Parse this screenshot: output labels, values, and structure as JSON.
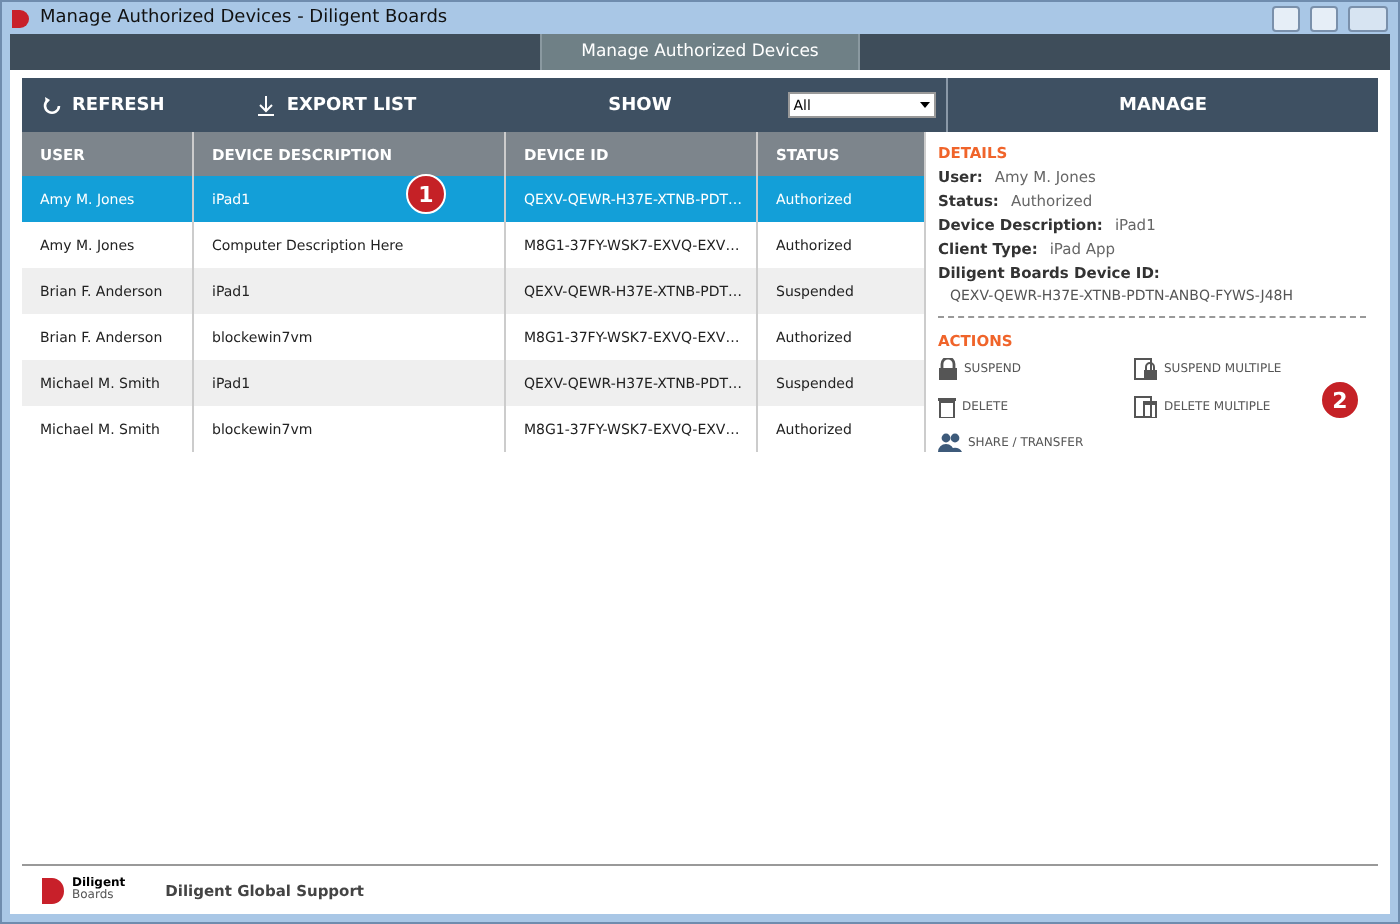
{
  "window": {
    "title": "Manage Authorized Devices - Diligent Boards"
  },
  "tabs": [
    {
      "label": "Manage Authorized Devices",
      "selected": true
    }
  ],
  "toolbar": {
    "refresh": "REFRESH",
    "export": "EXPORT LIST",
    "show_label": "SHOW",
    "show_value": "All",
    "manage": "MANAGE"
  },
  "table": {
    "columns": [
      "USER",
      "DEVICE DESCRIPTION",
      "DEVICE ID",
      "STATUS"
    ],
    "rows": [
      {
        "cells": [
          "Amy M. Jones",
          "iPad1",
          "QEXV-QEWR-H37E-XTNB-PDT…",
          "Authorized"
        ],
        "selected": true
      },
      {
        "cells": [
          "Amy M. Jones",
          "Computer Description Here",
          "M8G1-37FY-WSK7-EXVQ-EXV…",
          "Authorized"
        ],
        "selected": false
      },
      {
        "cells": [
          "Brian F. Anderson",
          "iPad1",
          "QEXV-QEWR-H37E-XTNB-PDT…",
          "Suspended"
        ],
        "selected": false
      },
      {
        "cells": [
          "Brian F. Anderson",
          "blockewin7vm",
          "M8G1-37FY-WSK7-EXVQ-EXV…",
          "Authorized"
        ],
        "selected": false
      },
      {
        "cells": [
          "Michael M. Smith",
          "iPad1",
          "QEXV-QEWR-H37E-XTNB-PDT…",
          "Suspended"
        ],
        "selected": false
      },
      {
        "cells": [
          "Michael M. Smith",
          "blockewin7vm",
          "M8G1-37FY-WSK7-EXVQ-EXV…",
          "Authorized"
        ],
        "selected": false
      }
    ]
  },
  "details": {
    "heading": "DETAILS",
    "fields": [
      {
        "label": "User:",
        "value": "Amy M. Jones"
      },
      {
        "label": "Status:",
        "value": "Authorized"
      },
      {
        "label": "Device Description:",
        "value": "iPad1"
      },
      {
        "label": "Client Type:",
        "value": "iPad App"
      }
    ],
    "id_label": "Diligent Boards Device ID:",
    "id_value": "QEXV-QEWR-H37E-XTNB-PDTN-ANBQ-FYWS-J48H"
  },
  "actions": {
    "heading": "ACTIONS",
    "items": [
      {
        "kind": "lock",
        "label": "SUSPEND"
      },
      {
        "kind": "lock-multi",
        "label": "SUSPEND MULTIPLE"
      },
      {
        "kind": "trash",
        "label": "DELETE"
      },
      {
        "kind": "trash-multi",
        "label": "DELETE MULTIPLE"
      },
      {
        "kind": "people",
        "label": "SHARE / TRANSFER"
      }
    ]
  },
  "callouts": [
    "1",
    "2"
  ],
  "footer": {
    "logo_top": "Diligent",
    "logo_bottom": "Boards",
    "link": "Diligent Global Support"
  }
}
